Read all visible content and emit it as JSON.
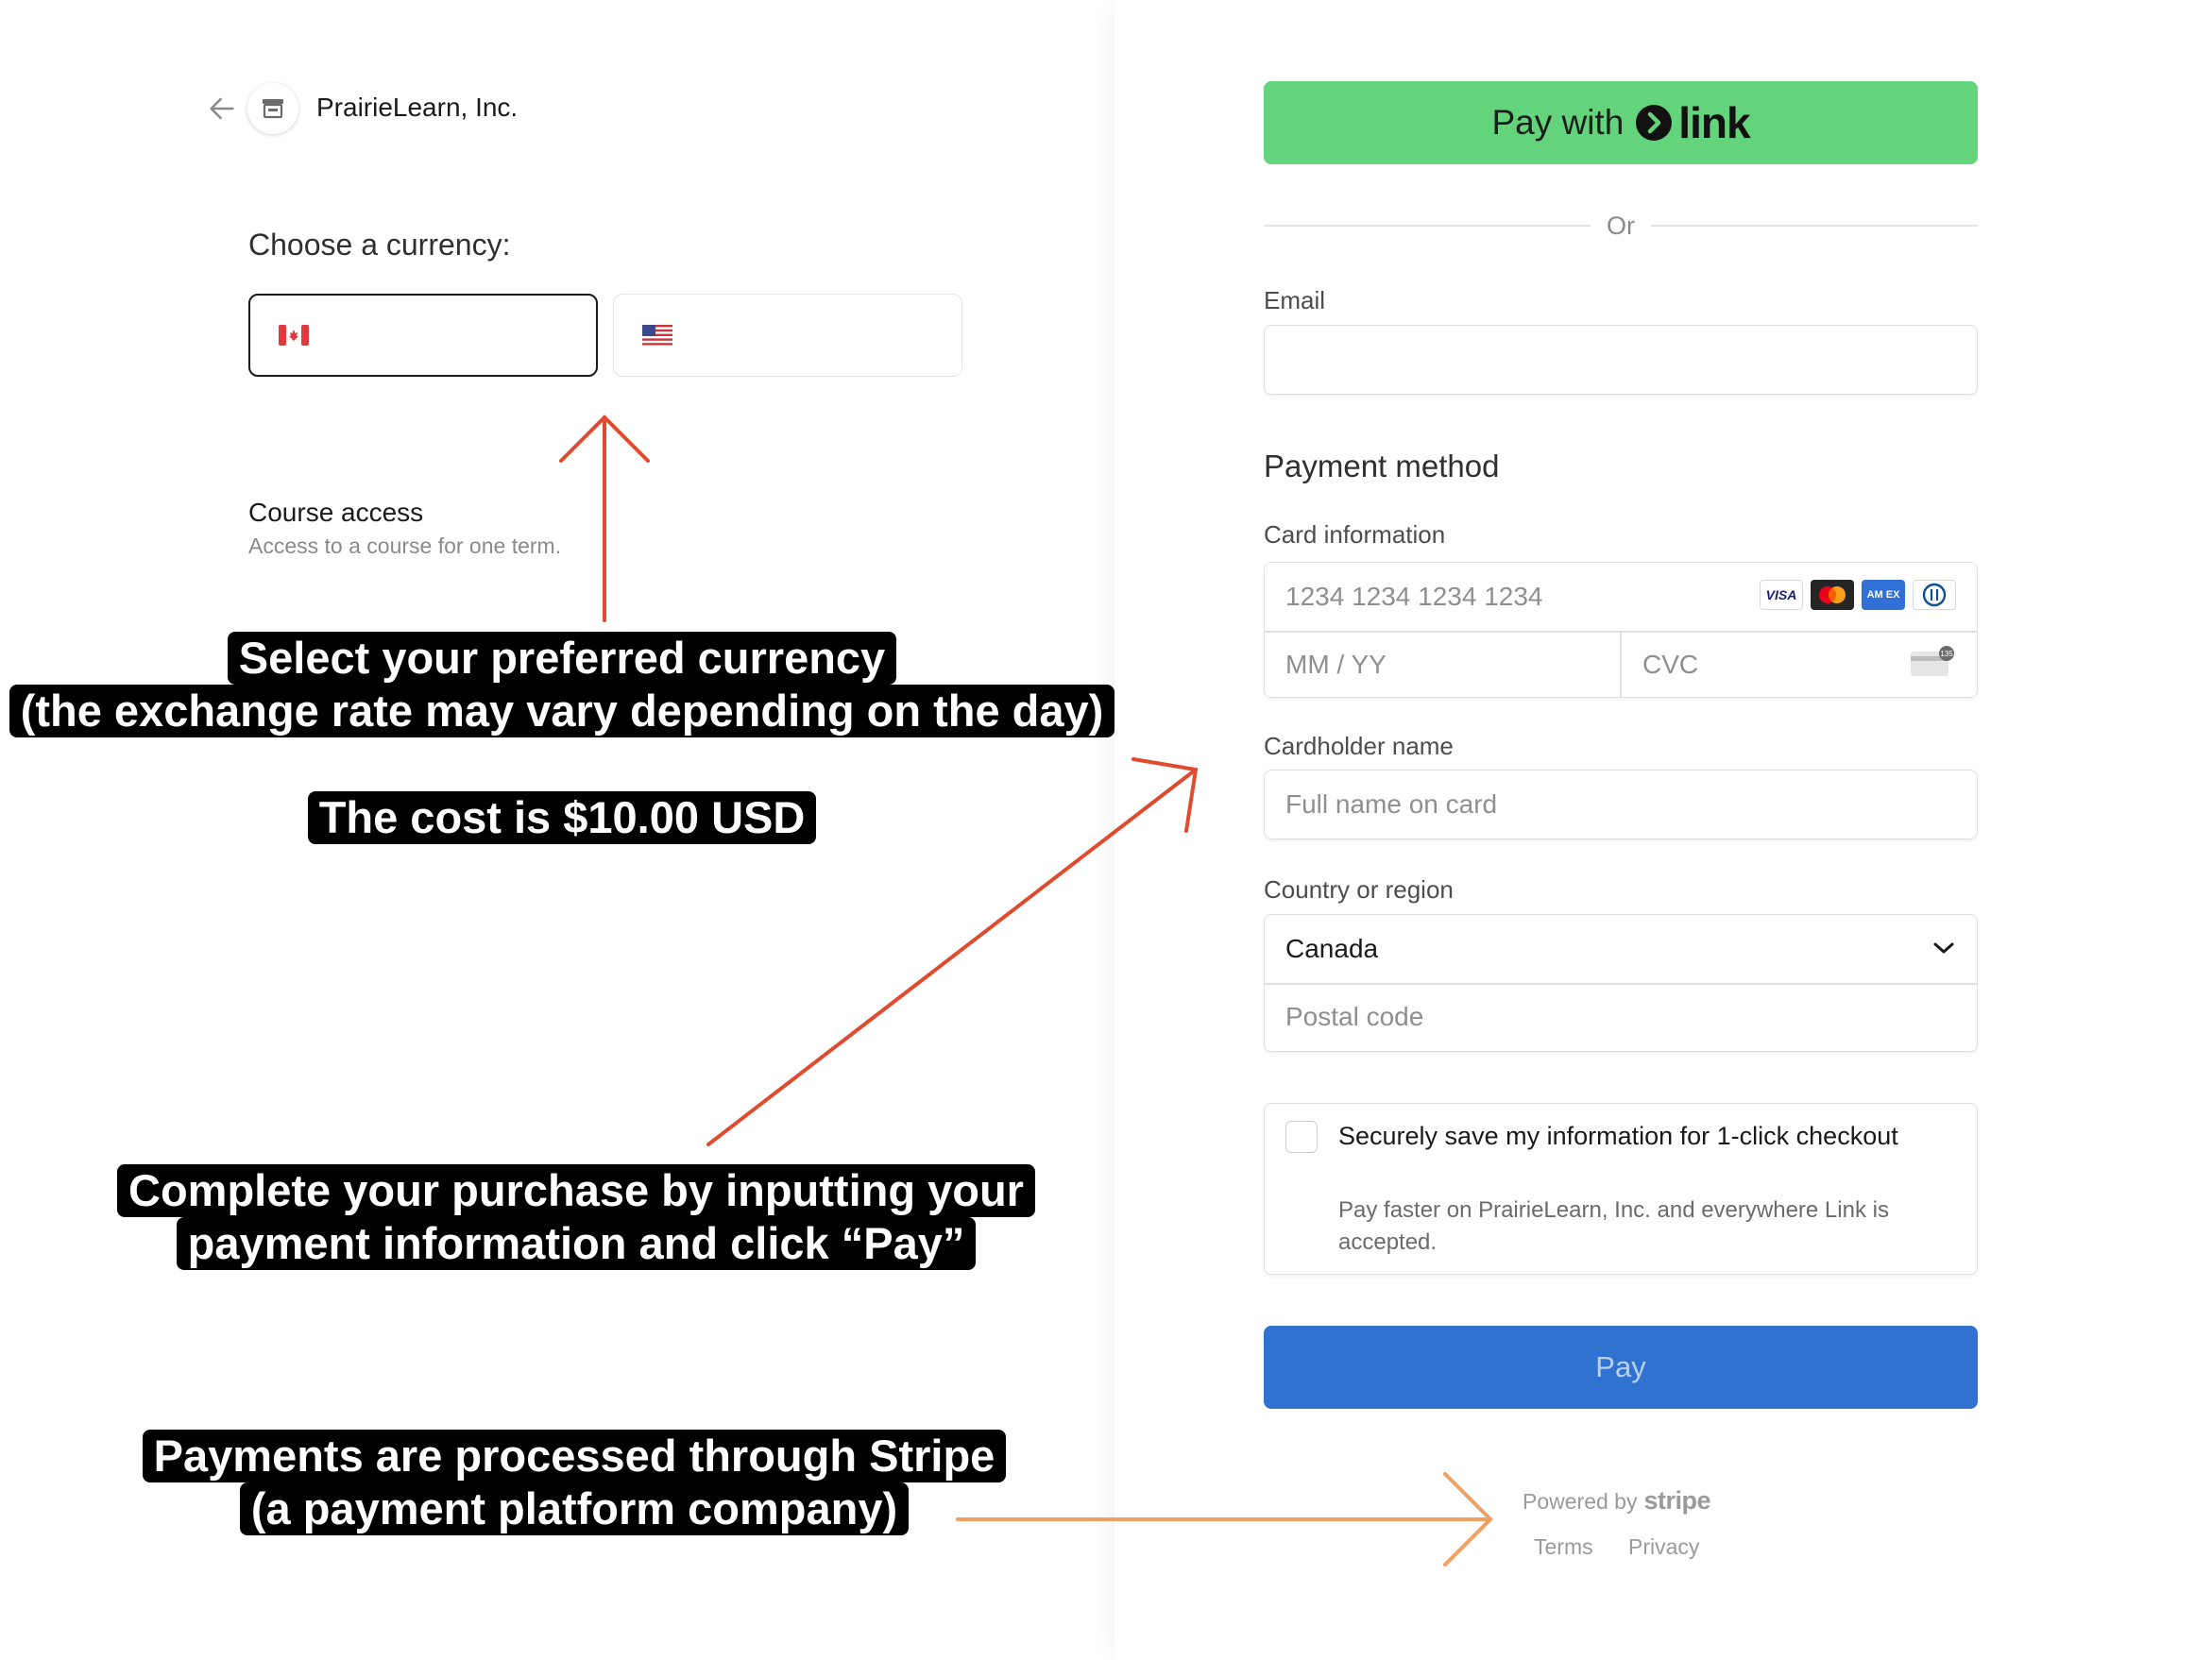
{
  "merchant": {
    "name": "PrairieLearn, Inc."
  },
  "currency": {
    "label": "Choose a currency:",
    "options": [
      {
        "flag": "canada-flag-icon",
        "value": "",
        "selected": true
      },
      {
        "flag": "us-flag-icon",
        "value": "",
        "selected": false
      }
    ]
  },
  "course": {
    "title": "Course access",
    "description": "Access to a course for one term."
  },
  "annotations": {
    "currency_line1": "Select your preferred currency",
    "currency_line2": "(the exchange rate may vary depending on the day)",
    "cost": "The cost is $10.00 USD",
    "purchase_line1": "Complete your purchase by inputting your",
    "purchase_line2": "payment information and click “Pay”",
    "stripe_line1": "Payments are processed through Stripe",
    "stripe_line2": "(a payment platform company)",
    "arrow_color_red": "#e04a2f",
    "arrow_color_orange": "#f0a060"
  },
  "checkout": {
    "link_button": {
      "prefix": "Pay with",
      "wordmark": "link",
      "color": "#63d47c"
    },
    "or": "Or",
    "email": {
      "label": "Email",
      "value": ""
    },
    "payment_method_title": "Payment method",
    "card": {
      "label": "Card information",
      "number_placeholder": "1234 1234 1234 1234",
      "expiry_placeholder": "MM / YY",
      "cvc_placeholder": "CVC",
      "brands": [
        "visa-icon",
        "mastercard-icon",
        "amex-icon",
        "diners-icon"
      ],
      "brand_visa": "VISA",
      "brand_amex": "AM EX",
      "cvc_badge": "135"
    },
    "cardholder": {
      "label": "Cardholder name",
      "placeholder": "Full name on card"
    },
    "country": {
      "label": "Country or region",
      "value": "Canada",
      "postal_placeholder": "Postal code"
    },
    "save": {
      "checked": false,
      "title": "Securely save my information for 1-click checkout",
      "description": "Pay faster on PrairieLearn, Inc. and everywhere Link is accepted."
    },
    "pay_button": {
      "label": "Pay",
      "color": "#2f72d0"
    },
    "footer": {
      "powered_by": "Powered by",
      "stripe": "stripe",
      "terms": "Terms",
      "privacy": "Privacy"
    }
  }
}
